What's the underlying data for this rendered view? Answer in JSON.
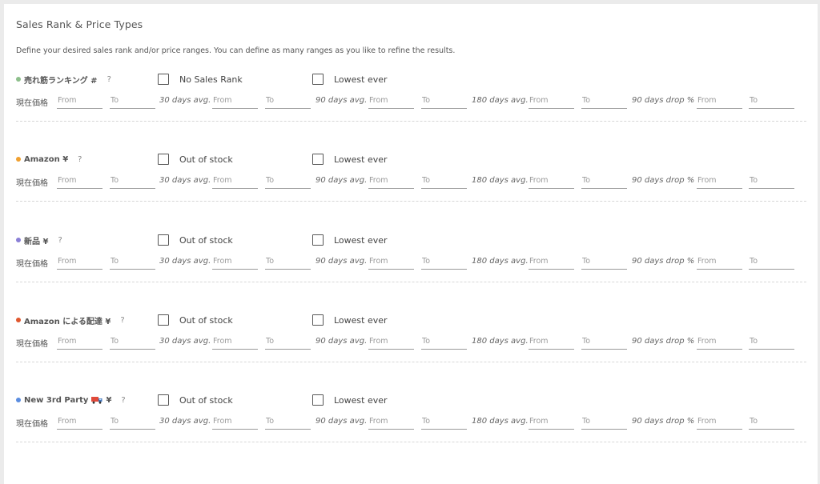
{
  "panel": {
    "title": "Sales Rank & Price Types",
    "description": "Define your desired sales rank and/or price ranges. You can define as many ranges as you like to refine the results."
  },
  "common": {
    "current_label": "現在価格",
    "from_placeholder": "From",
    "to_placeholder": "To",
    "avg30_label": "30 days avg.",
    "avg90_label": "90 days avg.",
    "avg180_label": "180 days avg.",
    "drop90_label": "90 days drop %",
    "help_label": "?",
    "lowest_ever_label": "Lowest ever"
  },
  "sections": [
    {
      "label": "売れ筋ランキング #",
      "dot_color": "#8dbf8b",
      "checkbox1_label": "No Sales Rank",
      "checkbox1_checked": false,
      "lowest_ever_checked": false,
      "icon": ""
    },
    {
      "label": "Amazon ¥",
      "dot_color": "#f0a030",
      "checkbox1_label": "Out of stock",
      "checkbox1_checked": false,
      "lowest_ever_checked": false,
      "icon": ""
    },
    {
      "label": "新品 ¥",
      "dot_color": "#8a7fd6",
      "checkbox1_label": "Out of stock",
      "checkbox1_checked": false,
      "lowest_ever_checked": false,
      "icon": ""
    },
    {
      "label": "Amazon による配達 ¥",
      "dot_color": "#e0572e",
      "checkbox1_label": "Out of stock",
      "checkbox1_checked": false,
      "lowest_ever_checked": false,
      "icon": ""
    },
    {
      "label": "New 3rd Party",
      "label_suffix": "¥",
      "dot_color": "#5b8de0",
      "checkbox1_label": "Out of stock",
      "checkbox1_checked": false,
      "lowest_ever_checked": false,
      "icon": "delivery-truck-icon"
    }
  ]
}
